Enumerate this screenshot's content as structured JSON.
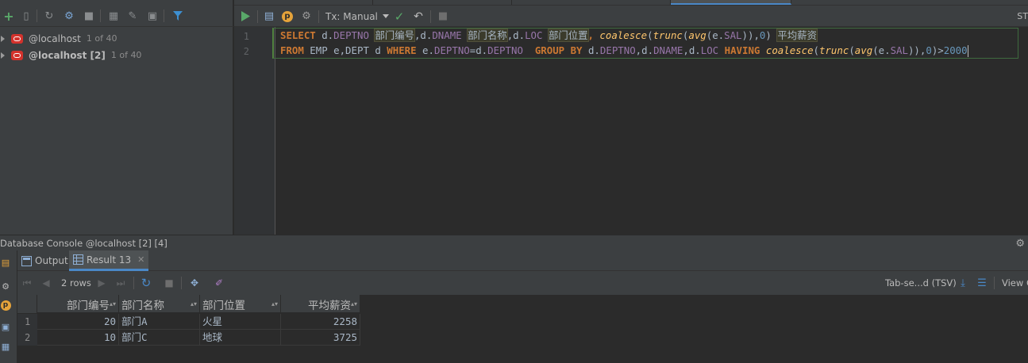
{
  "db_tree": {
    "hosts": [
      {
        "name": "@localhost",
        "count": "1 of 40",
        "bold": false
      },
      {
        "name": "@localhost [2]",
        "count": "1 of 40",
        "bold": true
      }
    ]
  },
  "editor": {
    "tx_mode": "Tx: Manual",
    "right_label": "ST",
    "line_numbers": [
      "1",
      "2"
    ],
    "line1": [
      {
        "t": "SELECT",
        "c": "kw"
      },
      {
        "t": " d.",
        "c": "id"
      },
      {
        "t": "DEPTNO",
        "c": "col"
      },
      {
        "t": " ",
        "c": "id"
      },
      {
        "t": "部门编号",
        "c": "alias"
      },
      {
        "t": ",d.",
        "c": "id"
      },
      {
        "t": "DNAME",
        "c": "col"
      },
      {
        "t": " ",
        "c": "id"
      },
      {
        "t": "部门名称",
        "c": "alias"
      },
      {
        "t": ",d.",
        "c": "id"
      },
      {
        "t": "LOC",
        "c": "col"
      },
      {
        "t": " ",
        "c": "id"
      },
      {
        "t": "部门位置",
        "c": "alias"
      },
      {
        "t": ", ",
        "c": "kw"
      },
      {
        "t": "coalesce",
        "c": "fn"
      },
      {
        "t": "(",
        "c": "id"
      },
      {
        "t": "trunc",
        "c": "fn"
      },
      {
        "t": "(",
        "c": "id"
      },
      {
        "t": "avg",
        "c": "fn"
      },
      {
        "t": "(e.",
        "c": "id"
      },
      {
        "t": "SAL",
        "c": "col"
      },
      {
        "t": ")),",
        "c": "id"
      },
      {
        "t": "0",
        "c": "num"
      },
      {
        "t": ") ",
        "c": "id"
      },
      {
        "t": "平均薪资",
        "c": "alias"
      }
    ],
    "line2": [
      {
        "t": "FROM",
        "c": "kw"
      },
      {
        "t": " EMP e,DEPT d ",
        "c": "id"
      },
      {
        "t": "WHERE",
        "c": "kw"
      },
      {
        "t": " e.",
        "c": "id"
      },
      {
        "t": "DEPTNO",
        "c": "col"
      },
      {
        "t": "=d.",
        "c": "id"
      },
      {
        "t": "DEPTNO",
        "c": "col"
      },
      {
        "t": "  ",
        "c": "id"
      },
      {
        "t": "GROUP BY",
        "c": "kw"
      },
      {
        "t": " d.",
        "c": "id"
      },
      {
        "t": "DEPTNO",
        "c": "col"
      },
      {
        "t": ",d.",
        "c": "id"
      },
      {
        "t": "DNAME",
        "c": "col"
      },
      {
        "t": ",d.",
        "c": "id"
      },
      {
        "t": "LOC",
        "c": "col"
      },
      {
        "t": " ",
        "c": "id"
      },
      {
        "t": "HAVING",
        "c": "kw"
      },
      {
        "t": " ",
        "c": "id"
      },
      {
        "t": "coalesce",
        "c": "fn"
      },
      {
        "t": "(",
        "c": "id"
      },
      {
        "t": "trunc",
        "c": "fn"
      },
      {
        "t": "(",
        "c": "id"
      },
      {
        "t": "avg",
        "c": "fn"
      },
      {
        "t": "(e.",
        "c": "id"
      },
      {
        "t": "SAL",
        "c": "col"
      },
      {
        "t": ")),",
        "c": "id"
      },
      {
        "t": "0",
        "c": "num"
      },
      {
        "t": ")>",
        "c": "id"
      },
      {
        "t": "2000",
        "c": "num"
      }
    ]
  },
  "console": {
    "title": "Database Console @localhost [2] [4]"
  },
  "results": {
    "tabs": [
      {
        "label": "Output",
        "active": false
      },
      {
        "label": "Result 13",
        "active": true
      }
    ],
    "rows_label": "2 rows",
    "export_format": "Tab-se...d (TSV)",
    "view_label": "View C",
    "columns": [
      "部门编号",
      "部门名称",
      "部门位置",
      "平均薪资"
    ],
    "rows": [
      {
        "num": "1",
        "cells": [
          "20",
          "部门A",
          "火星",
          "2258"
        ]
      },
      {
        "num": "2",
        "cells": [
          "10",
          "部门C",
          "地球",
          "3725"
        ]
      }
    ]
  },
  "colors": {
    "keyword": "#cc7832",
    "column": "#9876aa",
    "function": "#ffc66d",
    "number": "#6897bb",
    "run_green": "#59a869",
    "oracle_red": "#d3322c",
    "active_tab_underline": "#4a88c7"
  },
  "icons": {
    "db_toolbar": [
      "add-icon",
      "copy-icon",
      "refresh-icon",
      "properties-icon",
      "stop-icon",
      "table-icon",
      "edit-icon",
      "console-icon",
      "filter-icon"
    ],
    "editor_toolbar": [
      "run-icon",
      "console-icon",
      "p-icon",
      "wrench-icon",
      "commit-icon",
      "rollback-icon",
      "stop-icon"
    ],
    "results_toolbar": [
      "first-page-icon",
      "prev-page-icon",
      "next-page-icon",
      "last-page-icon",
      "refresh-icon",
      "stop-icon",
      "pin-icon",
      "compare-icon",
      "export-icon",
      "view-icon"
    ]
  }
}
